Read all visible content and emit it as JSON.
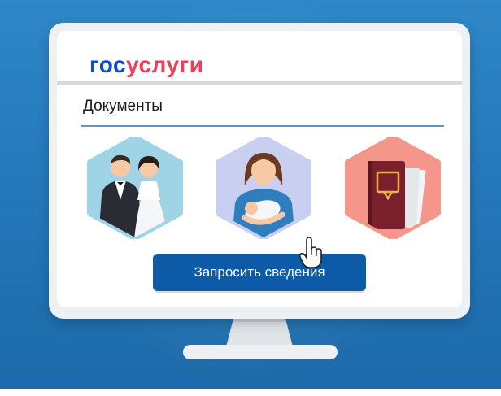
{
  "brand": {
    "part1": "гос",
    "part2": "услуги",
    "color1": "#0d4cd3",
    "color2": "#ee3f58"
  },
  "section": {
    "title": "Документы"
  },
  "cards": [
    {
      "icon": "wedding-couple-icon"
    },
    {
      "icon": "mother-with-baby-icon"
    },
    {
      "icon": "passport-icon"
    }
  ],
  "actions": {
    "request_label": "Запросить сведения",
    "cursor_icon": "hand-pointer-icon"
  },
  "colors": {
    "background": "#2479bb",
    "button": "#0d5aa7"
  }
}
